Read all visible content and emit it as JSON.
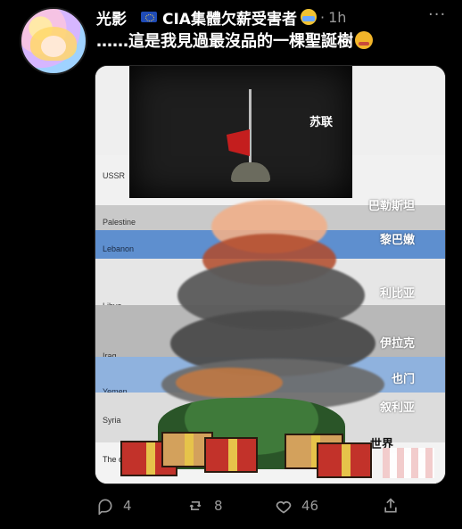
{
  "tweet": {
    "author_name": "光影",
    "handle": "CIA集體欠薪受害者",
    "separator": "·",
    "time": "1h",
    "text": "……這是我見過最沒品的一棵聖誕樹",
    "more_label": "···",
    "icons": {
      "flag": "eu-flag-icon",
      "handle_emoji": "face-mask-emoji-icon",
      "text_emoji": "sneezing-face-emoji-icon",
      "reply": "reply-icon",
      "retweet": "retweet-icon",
      "like": "heart-icon",
      "share": "share-icon"
    }
  },
  "media": {
    "labels": {
      "kremlin_zh": "苏联",
      "ussr": "USSR",
      "palestine_en": "Palestine",
      "palestine_zh": "巴勒斯坦",
      "lebanon_en": "Lebanon",
      "lebanon_zh": "黎巴嫩",
      "libya_en": "Libya",
      "libya_zh": "利比亚",
      "iraq_en": "Iraq",
      "iraq_zh": "伊拉克",
      "yemen_en": "Yemen",
      "yemen_zh": "也门",
      "syria_en": "Syria",
      "syria_zh": "叙利亚",
      "world_en": "The other world",
      "world_zh": "世界"
    }
  },
  "actions": {
    "reply_count": "4",
    "retweet_count": "8",
    "like_count": "46"
  },
  "colors": {
    "background": "#000000",
    "secondary_text": "#9a9a9a",
    "band_blue": "#5e8fcf"
  }
}
